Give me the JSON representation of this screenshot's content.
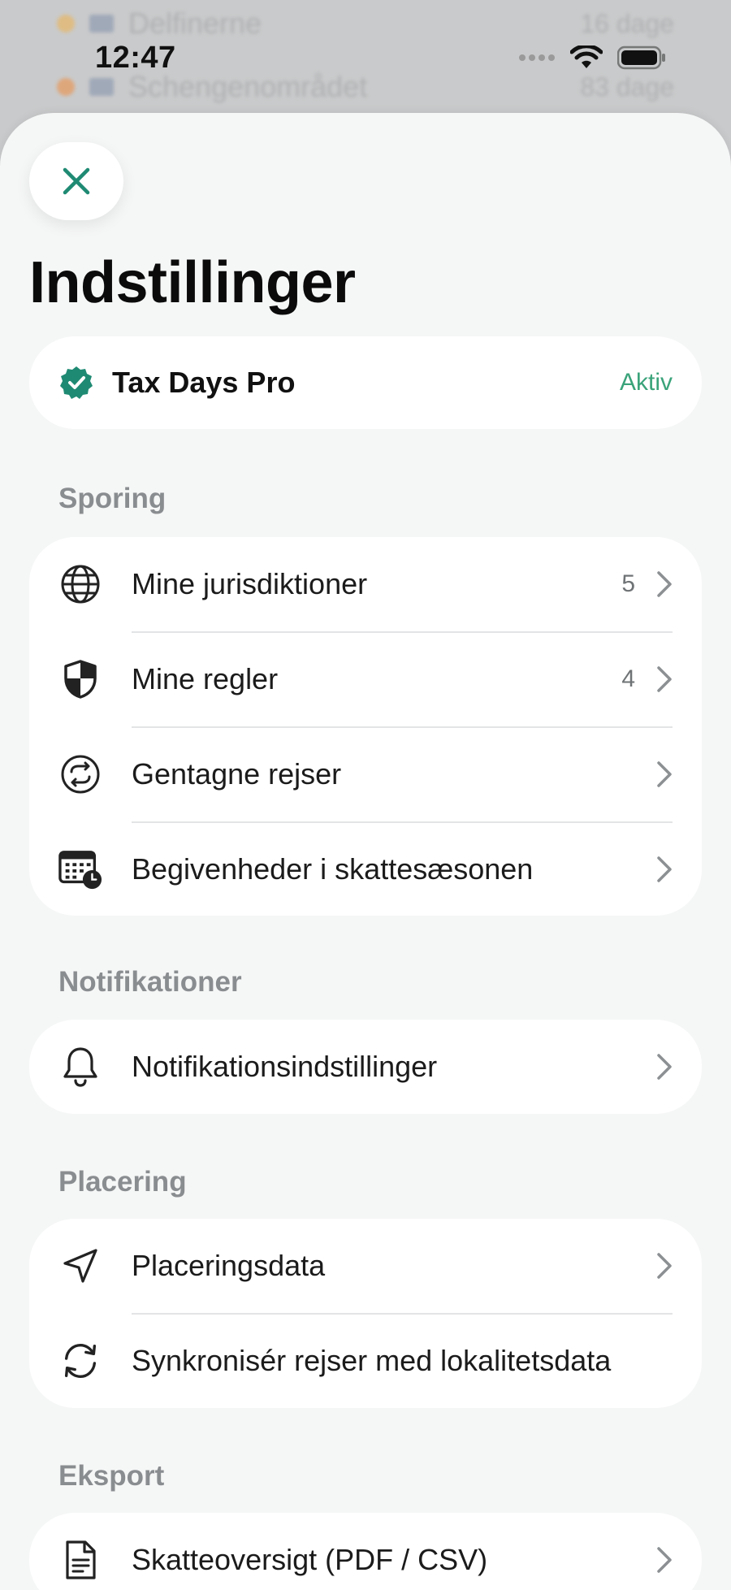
{
  "background": {
    "row1": {
      "label": "Delfinerne",
      "right": "16 dage"
    },
    "row2": {
      "label": "Schengenområdet",
      "right": "83 dage"
    }
  },
  "status_bar": {
    "time": "12:47"
  },
  "header": {
    "title": "Indstillinger"
  },
  "subscription": {
    "name": "Tax Days Pro",
    "status": "Aktiv",
    "icon": "verified-badge-icon",
    "accent": "#1f8a73"
  },
  "sections": {
    "tracking": {
      "label": "Sporing",
      "items": [
        {
          "label": "Mine jurisdiktioner",
          "count": "5",
          "icon": "globe-icon"
        },
        {
          "label": "Mine regler",
          "count": "4",
          "icon": "shield-icon"
        },
        {
          "label": "Gentagne rejser",
          "count": "",
          "icon": "repeat-icon"
        },
        {
          "label": "Begivenheder i skattesæsonen",
          "count": "",
          "icon": "calendar-clock-icon"
        }
      ]
    },
    "notifications": {
      "label": "Notifikationer",
      "items": [
        {
          "label": "Notifikationsindstillinger",
          "icon": "bell-icon"
        }
      ]
    },
    "location": {
      "label": "Placering",
      "items": [
        {
          "label": "Placeringsdata",
          "icon": "location-arrow-icon"
        },
        {
          "label": "Synkronisér rejser med lokalitetsdata",
          "icon": "sync-icon"
        }
      ]
    },
    "export": {
      "label": "Eksport",
      "items": [
        {
          "label": "Skatteoversigt (PDF / CSV)",
          "icon": "document-icon"
        }
      ]
    }
  },
  "colors": {
    "accent": "#1f8a73",
    "active_text": "#3aa37a",
    "sheet_bg": "#f5f6f6"
  }
}
